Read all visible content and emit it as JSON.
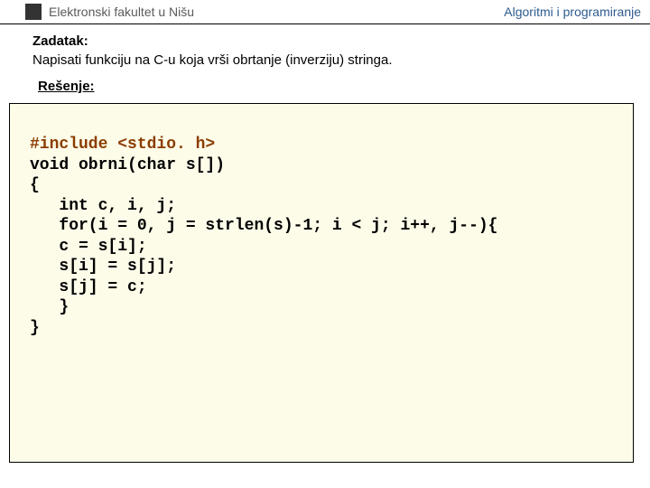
{
  "header": {
    "left": "Elektronski fakultet u Nišu",
    "right": "Algoritmi i programiranje"
  },
  "task": {
    "label": "Zadatak:",
    "text": "Napisati funkciju na C-u koja vrši obrtanje (inverziju) stringa."
  },
  "solution": {
    "label": "Rešenje:",
    "code_include": "#include <stdio. h>",
    "code_body": "void obrni(char s[])\n{\n   int c, i, j;\n   for(i = 0, j = strlen(s)-1; i < j; i++, j--){\n   c = s[i];\n   s[i] = s[j];\n   s[j] = c;\n   }\n}"
  }
}
